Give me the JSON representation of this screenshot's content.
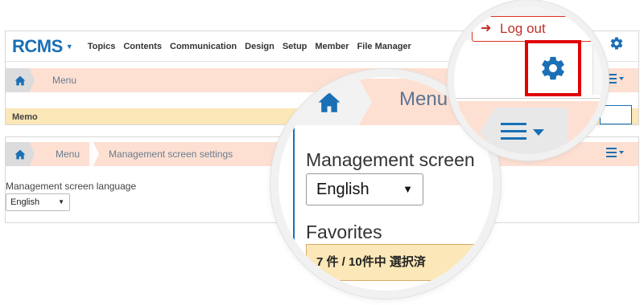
{
  "topnav": {
    "logo": "RCMS",
    "items": [
      "Topics",
      "Contents",
      "Communication",
      "Design",
      "Setup",
      "Member",
      "File Manager"
    ]
  },
  "breadcrumb1": {
    "menu": "Menu"
  },
  "memo": {
    "label": "Memo"
  },
  "breadcrumb2": {
    "menu": "Menu",
    "current": "Management screen settings"
  },
  "settings": {
    "language_label": "Management screen language",
    "language_value": "English"
  },
  "zoom": {
    "menu": "Menu",
    "language_label": "Management screen",
    "language_value": "English",
    "favorites_label": "Favorites",
    "count_text": "7 件 / 10件中 選択済",
    "logout_label": "Log out"
  },
  "colors": {
    "brand": "#1a6fb5",
    "breadcrumb_bg": "#fde0d2",
    "memo_bg": "#fbe7b7",
    "highlight_box": "#e00000",
    "logout_red": "#c0302a"
  }
}
